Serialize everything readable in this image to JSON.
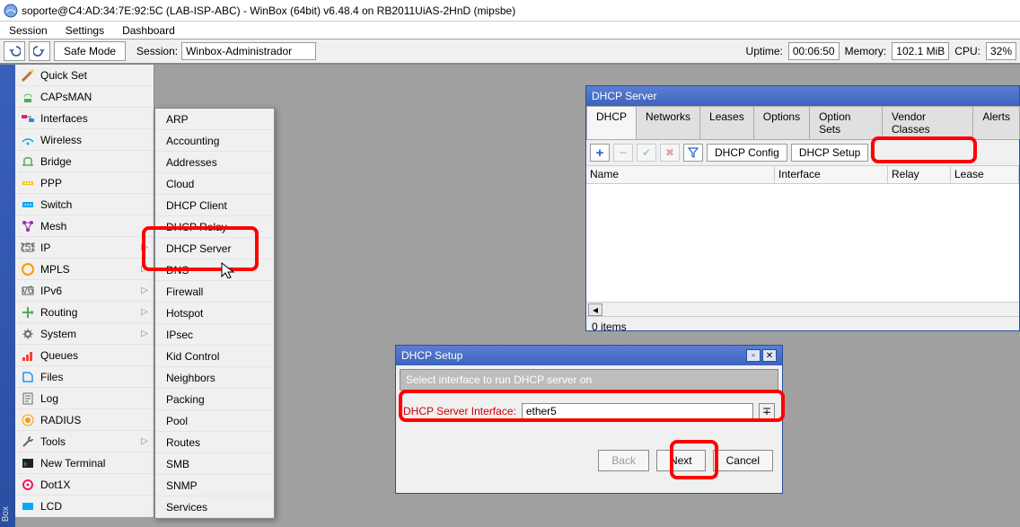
{
  "title": "soporte@C4:AD:34:7E:92:5C (LAB-ISP-ABC) - WinBox (64bit) v6.48.4 on RB2011UiAS-2HnD (mipsbe)",
  "menubar": [
    "Session",
    "Settings",
    "Dashboard"
  ],
  "toolbar": {
    "safe_mode": "Safe Mode",
    "session_label": "Session:",
    "session_value": "Winbox-Administrador",
    "uptime_label": "Uptime:",
    "uptime_value": "00:06:50",
    "memory_label": "Memory:",
    "memory_value": "102.1 MiB",
    "cpu_label": "CPU:",
    "cpu_value": "32%"
  },
  "sidebar": [
    "Quick Set",
    "CAPsMAN",
    "Interfaces",
    "Wireless",
    "Bridge",
    "PPP",
    "Switch",
    "Mesh",
    "IP",
    "MPLS",
    "IPv6",
    "Routing",
    "System",
    "Queues",
    "Files",
    "Log",
    "RADIUS",
    "Tools",
    "New Terminal",
    "Dot1X",
    "LCD"
  ],
  "submenu": [
    "ARP",
    "Accounting",
    "Addresses",
    "Cloud",
    "DHCP Client",
    "DHCP Relay",
    "DHCP Server",
    "DNS",
    "Firewall",
    "Hotspot",
    "IPsec",
    "Kid Control",
    "Neighbors",
    "Packing",
    "Pool",
    "Routes",
    "SMB",
    "SNMP",
    "Services"
  ],
  "dhcp_win": {
    "title": "DHCP Server",
    "tabs": [
      "DHCP",
      "Networks",
      "Leases",
      "Options",
      "Option Sets",
      "Vendor Classes",
      "Alerts"
    ],
    "dhcp_config": "DHCP Config",
    "dhcp_setup": "DHCP Setup",
    "cols": [
      "Name",
      "Interface",
      "Relay",
      "Lease"
    ],
    "status": "0 items"
  },
  "dlg": {
    "title": "DHCP Setup",
    "instr": "Select interface to run DHCP server on",
    "field_label": "DHCP Server Interface:",
    "field_value": "ether5",
    "back": "Back",
    "next": "Next",
    "cancel": "Cancel"
  },
  "romo": "Box"
}
